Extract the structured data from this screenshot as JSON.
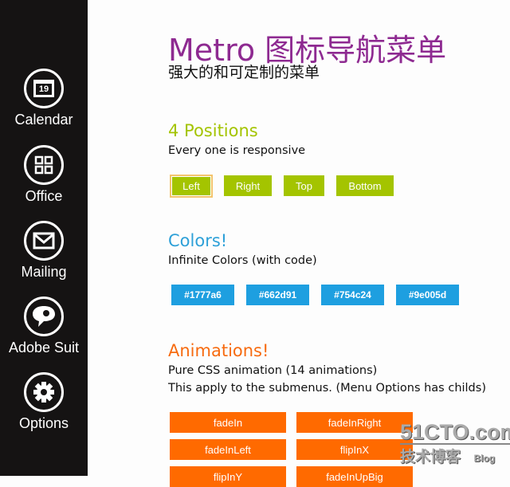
{
  "sidebar": {
    "items": [
      {
        "label": "Calendar",
        "icon": "calendar-icon",
        "day": "19"
      },
      {
        "label": "Office",
        "icon": "office-icon"
      },
      {
        "label": "Mailing",
        "icon": "mail-icon"
      },
      {
        "label": "Adobe Suit",
        "icon": "adobe-icon"
      },
      {
        "label": "Options",
        "icon": "gear-icon"
      }
    ]
  },
  "header": {
    "title": "Metro 图标导航菜单",
    "subtitle": "强大的和可定制的菜单"
  },
  "positions": {
    "heading": "4 Positions",
    "desc": "Every one is responsive",
    "color": "#a4c400",
    "buttons": [
      "Left",
      "Right",
      "Top",
      "Bottom"
    ],
    "selected": "Left"
  },
  "colors": {
    "heading": "Colors!",
    "desc": "Infinite Colors (with code)",
    "color": "#1e9fe0",
    "buttons": [
      "#1777a6",
      "#662d91",
      "#754c24",
      "#9e005d"
    ]
  },
  "animations": {
    "heading": "Animations!",
    "desc1": "Pure CSS animation (14 animations)",
    "desc2": "This apply to the submenus. (Menu Options has childs)",
    "color": "#ff6a00",
    "buttons": [
      "fadeIn",
      "fadeInRight",
      "fadeInLeft",
      "flipInX",
      "flipInY",
      "fadeInUpBig"
    ]
  },
  "watermark": {
    "line1": "51CTO.com",
    "line2": "技术博客",
    "line3": "Blog"
  }
}
